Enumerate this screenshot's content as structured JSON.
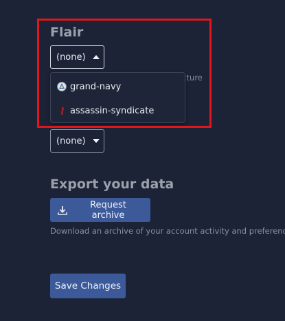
{
  "flair": {
    "heading": "Flair",
    "select_open_value": "(none)",
    "hidden_text_fragment": "icture",
    "options": [
      {
        "label": "grand-navy",
        "icon": "grand-navy-flair-icon"
      },
      {
        "label": "assassin-syndicate",
        "icon": "assassin-syndicate-flair-icon"
      }
    ],
    "select_closed_value": "(none)"
  },
  "export": {
    "heading": "Export your data",
    "request_label": "Request archive",
    "description": "Download an archive of your account activity and preferences"
  },
  "save_label": "Save Changes",
  "colors": {
    "background": "#1c2336",
    "button": "#3c5a9a",
    "highlight": "#e0161b"
  }
}
